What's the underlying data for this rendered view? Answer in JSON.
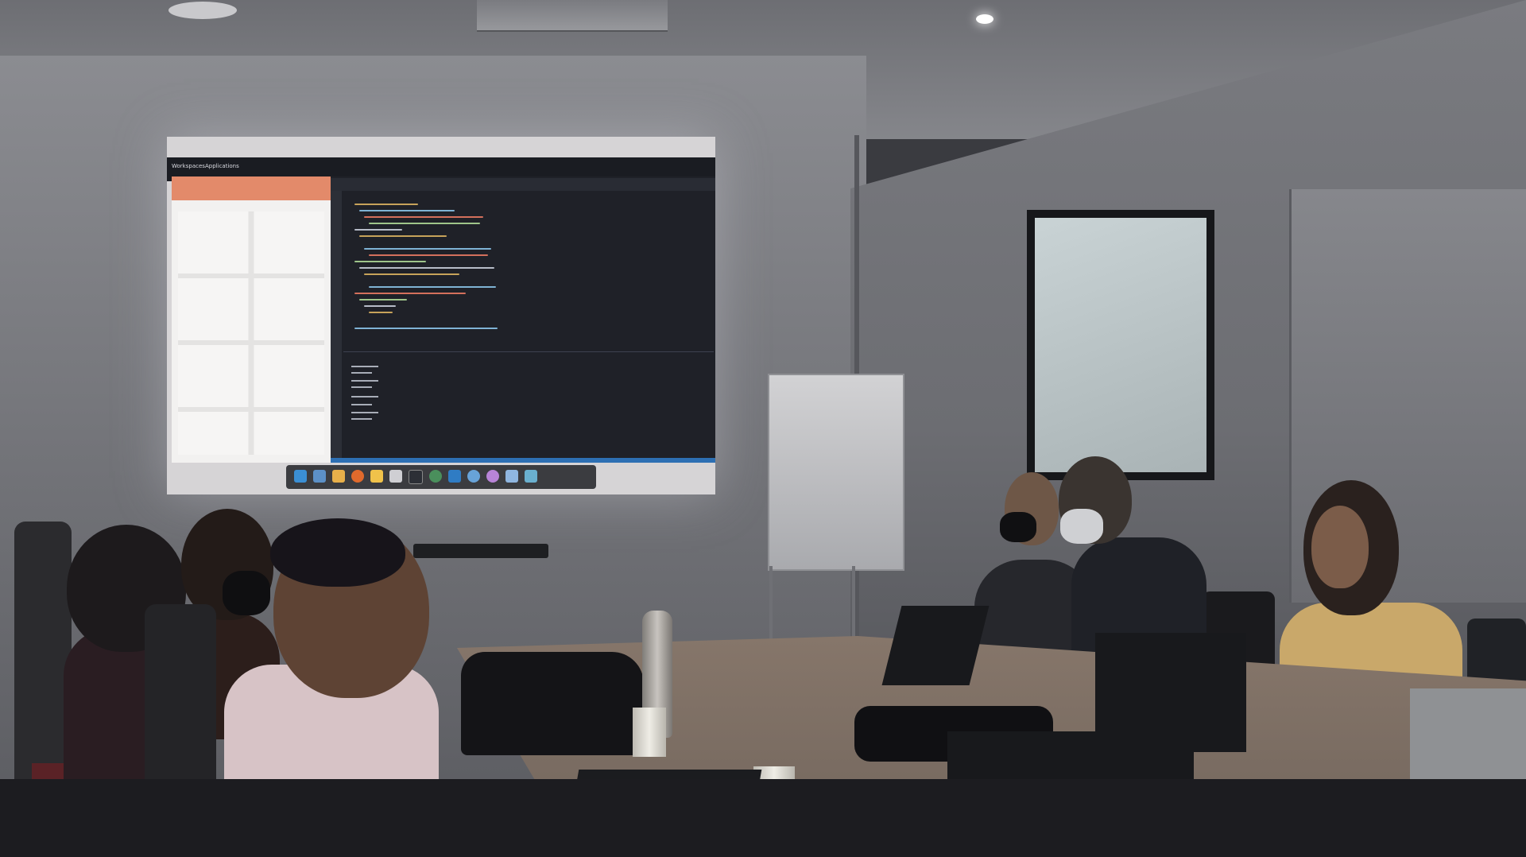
{
  "scene": {
    "projection": {
      "top_bar": {
        "workspaces_label": "Workspaces",
        "applications_label": "Applications"
      }
    }
  },
  "colors": {
    "editor_bg": "#1f2128",
    "status_bar": "#2d6fb3",
    "browser_accent": "#e38a6a",
    "table_wood": "#86766a",
    "wall": "#7c7d82"
  },
  "icons": [
    "vscode-icon",
    "files-icon",
    "apps-grid-icon",
    "firefox-icon",
    "chrome-icon",
    "terminal-icon"
  ]
}
